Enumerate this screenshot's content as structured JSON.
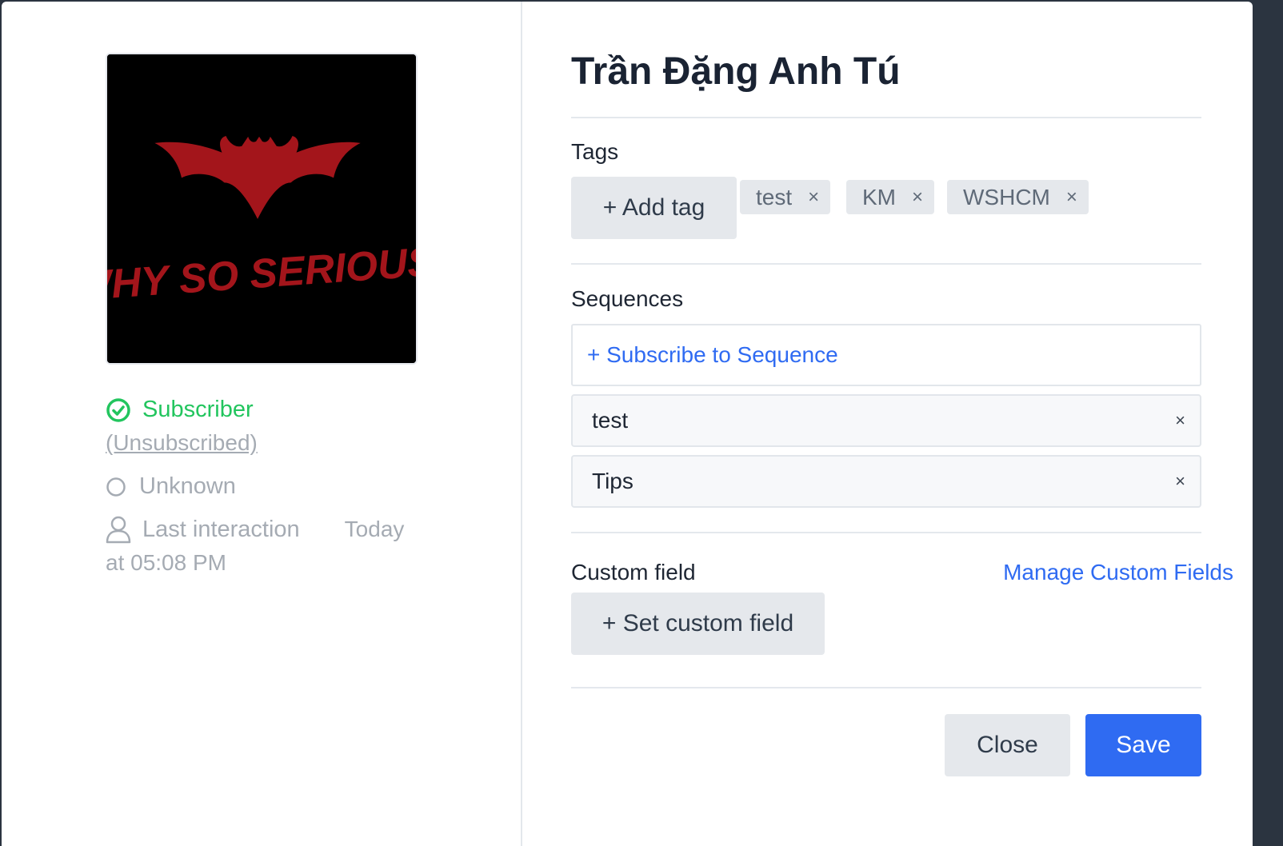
{
  "profile": {
    "avatar_text": "WHY SO SERIOUS?",
    "status_label": "Subscriber",
    "unsubscribed_link": "(Unsubscribed)",
    "gender_label": "Unknown",
    "last_interaction_label": "Last interaction",
    "last_interaction_day": "Today",
    "last_interaction_time": "at 05:08 PM",
    "colors": {
      "status_green": "#22c55e",
      "muted": "#a5abb3"
    }
  },
  "details": {
    "name": "Trần Đặng Anh Tú",
    "tags": {
      "label": "Tags",
      "add_button": "+ Add tag",
      "items": [
        "test",
        "KM",
        "WSHCM"
      ],
      "remove_symbol": "×"
    },
    "sequences": {
      "label": "Sequences",
      "subscribe_button": "+ Subscribe to Sequence",
      "items": [
        "test",
        "Tips"
      ],
      "remove_symbol": "×"
    },
    "custom_field": {
      "label": "Custom field",
      "manage_link": "Manage Custom Fields",
      "set_button": "+ Set custom field"
    }
  },
  "footer": {
    "close_label": "Close",
    "save_label": "Save",
    "colors": {
      "primary": "#2f6bf2"
    }
  }
}
